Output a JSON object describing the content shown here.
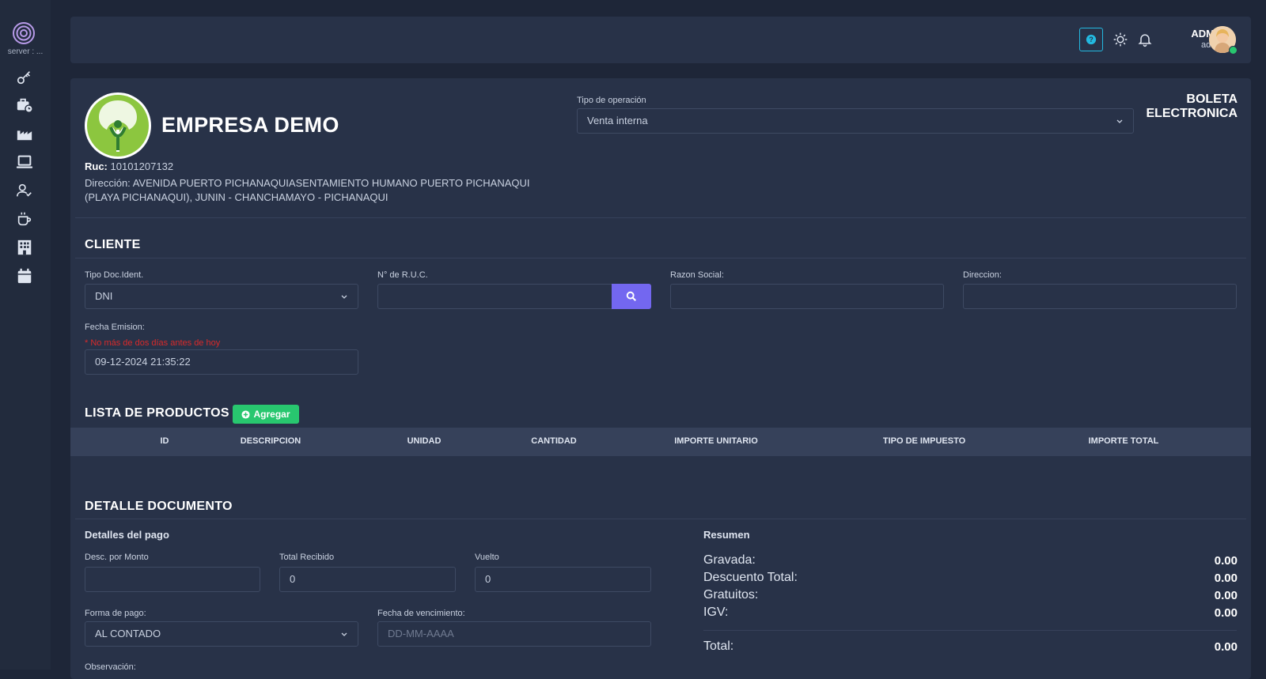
{
  "sidebar": {
    "server_label": "server : ...",
    "icons": [
      "key-icon",
      "briefcase-clock-icon",
      "factory-icon",
      "laptop-icon",
      "user-check-icon",
      "coffee-icon",
      "building-icon",
      "calendar-icon"
    ]
  },
  "header": {
    "user_name": "ADMIN",
    "user_role": "admin"
  },
  "company": {
    "name": "EMPRESA DEMO",
    "ruc_label": "Ruc:",
    "ruc_value": "10101207132",
    "direccion": "Dirección: AVENIDA PUERTO PICHANAQUIASENTAMIENTO HUMANO PUERTO PICHANAQUI (PLAYA PICHANAQUI), JUNIN - CHANCHAMAYO - PICHANAQUI"
  },
  "operation": {
    "label": "Tipo de operación",
    "value": "Venta interna"
  },
  "document_type": {
    "line1": "BOLETA",
    "line2": "ELECTRONICA"
  },
  "cliente": {
    "title": "CLIENTE",
    "tipo_doc_label": "Tipo Doc.Ident.",
    "tipo_doc_value": "DNI",
    "ruc_label": "N° de R.U.C.",
    "ruc_value": "",
    "razon_label": "Razon Social:",
    "razon_value": "",
    "direccion_label": "Direccion:",
    "direccion_value": "",
    "fecha_label": "Fecha Emision:",
    "fecha_warning": "* No más de dos días antes de hoy",
    "fecha_value": "09-12-2024 21:35:22"
  },
  "productos": {
    "title": "LISTA DE PRODUCTOS",
    "add_label": "Agregar",
    "columns": [
      "ID",
      "DESCRIPCION",
      "UNIDAD",
      "CANTIDAD",
      "IMPORTE UNITARIO",
      "TIPO DE IMPUESTO",
      "IMPORTE TOTAL"
    ]
  },
  "detalle": {
    "title": "DETALLE DOCUMENTO",
    "pago_title": "Detalles del pago",
    "desc_label": "Desc. por Monto",
    "desc_value": "",
    "total_recibido_label": "Total Recibido",
    "total_recibido_value": "0",
    "vuelto_label": "Vuelto",
    "vuelto_value": "0",
    "forma_pago_label": "Forma de pago:",
    "forma_pago_value": "AL CONTADO",
    "vencimiento_label": "Fecha de vencimiento:",
    "vencimiento_placeholder": "DD-MM-AAAA",
    "observacion_label": "Observación:"
  },
  "resumen": {
    "title": "Resumen",
    "rows": [
      {
        "label": "Gravada:",
        "value": "0.00"
      },
      {
        "label": "Descuento Total:",
        "value": "0.00"
      },
      {
        "label": "Gratuitos:",
        "value": "0.00"
      },
      {
        "label": "IGV:",
        "value": "0.00"
      }
    ],
    "total_label": "Total:",
    "total_value": "0.00"
  },
  "colors": {
    "accent": "#7367f0",
    "success": "#28c76f",
    "info": "#23b9e0",
    "danger": "#d92a2a"
  }
}
